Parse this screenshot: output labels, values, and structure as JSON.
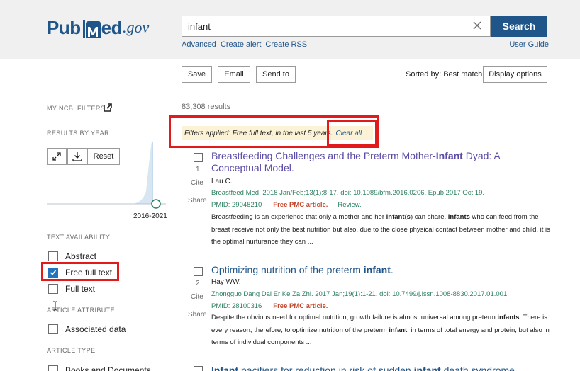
{
  "header": {
    "logo_pub": "Pub",
    "logo_ed": "ed",
    "logo_gov": ".gov",
    "search_value": "infant",
    "search_button": "Search",
    "links": [
      "Advanced",
      "Create alert",
      "Create RSS"
    ],
    "user_guide": "User Guide"
  },
  "toolbar": {
    "save": "Save",
    "email": "Email",
    "send_to": "Send to",
    "sorted_by": "Sorted by: Best match",
    "display_options": "Display options"
  },
  "sidebar": {
    "my_filters": "MY NCBI FILTERS",
    "results_by_year": "RESULTS BY YEAR",
    "reset": "Reset",
    "year_range": "2016-2021",
    "text_availability": "TEXT AVAILABILITY",
    "abstract": "Abstract",
    "free_full_text": "Free full text",
    "full_text": "Full text",
    "article_attribute": "ARTICLE ATTRIBUTE",
    "associated_data": "Associated data",
    "article_type": "ARTICLE TYPE",
    "books_and_documents": "Books and Documents"
  },
  "main": {
    "results_count": "83,308 results",
    "filters_applied": "Filters applied: Free full text, in the last 5 years.",
    "clear_all": "Clear all",
    "cite": "Cite",
    "share": "Share",
    "results": [
      {
        "num": "1",
        "title_a": "Breastfeeding Challenges and the Preterm Mother-",
        "title_b": "Infant",
        "title_c": " Dyad: A Conceptual Model.",
        "authors": "Lau C.",
        "journal": "Breastfeed Med. 2018 Jan/Feb;13(1):8-17. doi: 10.1089/bfm.2016.0206. Epub 2017 Oct 19.",
        "pmid": "PMID: 29048210",
        "pmc": "Free PMC article.",
        "review": "Review.",
        "snippet": [
          {
            "t": "Breastfeeding is an experience that only a mother and her "
          },
          {
            "b": "infant"
          },
          {
            "t": "("
          },
          {
            "b": "s"
          },
          {
            "t": ") can share. "
          },
          {
            "b": "Infants"
          },
          {
            "t": " who can feed from the breast receive not only the best nutrition but also, due to the close physical contact between mother and child, it is the optimal nurturance they can ..."
          }
        ]
      },
      {
        "num": "2",
        "title_a": "Optimizing nutrition of the preterm ",
        "title_b": "infant",
        "title_c": ".",
        "authors": "Hay WW.",
        "journal": "Zhongguo Dang Dai Er Ke Za Zhi. 2017 Jan;19(1):1-21. doi: 10.7499/j.issn.1008-8830.2017.01.001.",
        "pmid": "PMID: 28100316",
        "pmc": "Free PMC article.",
        "review": "",
        "snippet": [
          {
            "t": "Despite the obvious need for optimal nutrition, growth failure is almost universal among preterm "
          },
          {
            "b": "infants"
          },
          {
            "t": ". There is every reason, therefore, to optimize nutrition of the preterm "
          },
          {
            "b": "infant"
          },
          {
            "t": ", in terms of total energy and protein, but also in terms of individual components ..."
          }
        ]
      },
      {
        "title_a": "",
        "title_b": "Infant",
        "title_c": " pacifiers for reduction in risk of sudden ",
        "title_d": "infant",
        "title_e": " death syndrome."
      }
    ]
  },
  "colors": {
    "brand": "#20558a",
    "highlight_box": "#e11b1b",
    "free_pmc": "#c4492f",
    "journal_green": "#2f8060",
    "filter_bg": "#fcf3d7"
  }
}
